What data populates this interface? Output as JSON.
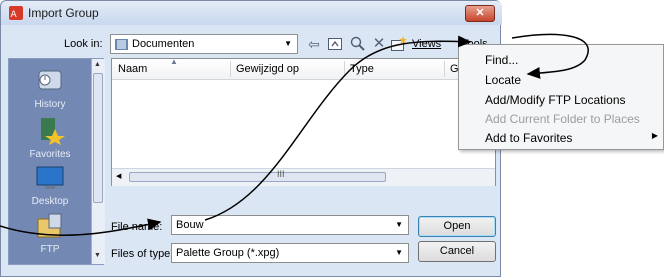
{
  "window": {
    "title": "Import Group",
    "close_label": "✕"
  },
  "look_in": {
    "label": "Look in:",
    "value": "Documenten"
  },
  "toolbar": {
    "views_label": "Views",
    "tools_label": "Tools"
  },
  "places": [
    {
      "label": "History",
      "icon": "history-icon"
    },
    {
      "label": "Favorites",
      "icon": "favorites-icon"
    },
    {
      "label": "Desktop",
      "icon": "desktop-icon"
    },
    {
      "label": "FTP",
      "icon": "ftp-icon"
    }
  ],
  "file_list": {
    "columns": [
      "Naam",
      "Gewijzigd op",
      "Type",
      "Gr"
    ],
    "rows": [],
    "scroll_grip": "III"
  },
  "file_name": {
    "label": "File name:",
    "value": "Bouw"
  },
  "file_type": {
    "label": "Files of type:",
    "value": "Palette Group (*.xpg)"
  },
  "buttons": {
    "open": "Open",
    "cancel": "Cancel"
  },
  "tools_menu": {
    "items": [
      {
        "label": "Find...",
        "enabled": true
      },
      {
        "label": "Locate",
        "enabled": true
      },
      {
        "label": "Add/Modify FTP Locations",
        "enabled": true
      },
      {
        "label": "Add Current Folder to Places",
        "enabled": false
      },
      {
        "label": "Add to Favorites",
        "enabled": true,
        "submenu": true
      }
    ]
  },
  "colors": {
    "places_bg": "#7488b4",
    "dialog_bg": "#dbe6f4",
    "close_red": "#c6452c"
  }
}
